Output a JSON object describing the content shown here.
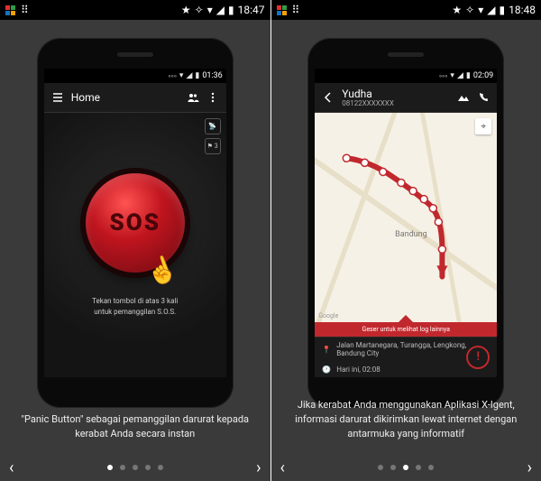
{
  "panels": [
    {
      "outer_time": "18:47",
      "inner_time": "01:36",
      "appbar": {
        "title": "Home"
      },
      "sos_label": "SOS",
      "side_count": "⚑ 3",
      "instruction_line1": "Tekan tombol di atas 3 kali",
      "instruction_line2": "untuk pemanggilan S.O.S.",
      "caption": "\"Panic Button\" sebagai pemanggilan darurat kepada kerabat Anda secara instan",
      "pager": {
        "total": 5,
        "active": 0
      }
    },
    {
      "outer_time": "18:48",
      "inner_time": "02:09",
      "appbar": {
        "title": "Yudha",
        "sub": "08122XXXXXXX"
      },
      "map": {
        "city": "Bandung",
        "brand": "Google"
      },
      "log_hint": "Geser untuk melihat log lainnya",
      "address": "Jalan Martanegara, Turangga, Lengkong, Bandung City",
      "timestamp": "Hari ini, 02:08",
      "caption": "Jika kerabat Anda menggunakan Aplikasi X-Igent, informasi darurat dikirimkan lewat internet dengan antarmuka yang informatif",
      "pager": {
        "total": 5,
        "active": 2
      }
    }
  ]
}
